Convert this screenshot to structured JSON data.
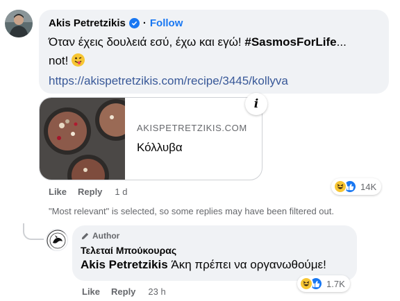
{
  "comment": {
    "author": "Akis Petretzikis",
    "follow_label": "Follow",
    "text_main": "Όταν έχεις δουλειά εσύ, έχω και εγώ! ",
    "hashtag": "#SasmosForLife",
    "text_after_hashtag": "...",
    "text_line2": "not! ",
    "link": "https://akispetretzikis.com/recipe/3445/kollyva",
    "preview": {
      "domain": "AKISPETRETZIKIS.COM",
      "title": "Κόλλυβα"
    },
    "actions": {
      "like": "Like",
      "reply": "Reply",
      "time": "1 d"
    },
    "reactions": {
      "count": "14K",
      "icons": [
        "haha-icon",
        "like-icon"
      ]
    }
  },
  "filter_note": "\"Most relevant\" is selected, so some replies may have been filtered out.",
  "reply": {
    "badge": "Author",
    "author": "Τελεταί Μπούκουρας",
    "mention": "Akis Petretzikis",
    "text": " Άκη πρέπει να οργανωθούμε!",
    "actions": {
      "like": "Like",
      "reply": "Reply",
      "time": "23 h"
    },
    "reactions": {
      "count": "1.7K",
      "icons": [
        "haha-icon",
        "like-icon"
      ]
    }
  },
  "colors": {
    "accent": "#1877f2",
    "bubble": "#f0f2f5",
    "muted": "#65676b",
    "link": "#385898"
  }
}
